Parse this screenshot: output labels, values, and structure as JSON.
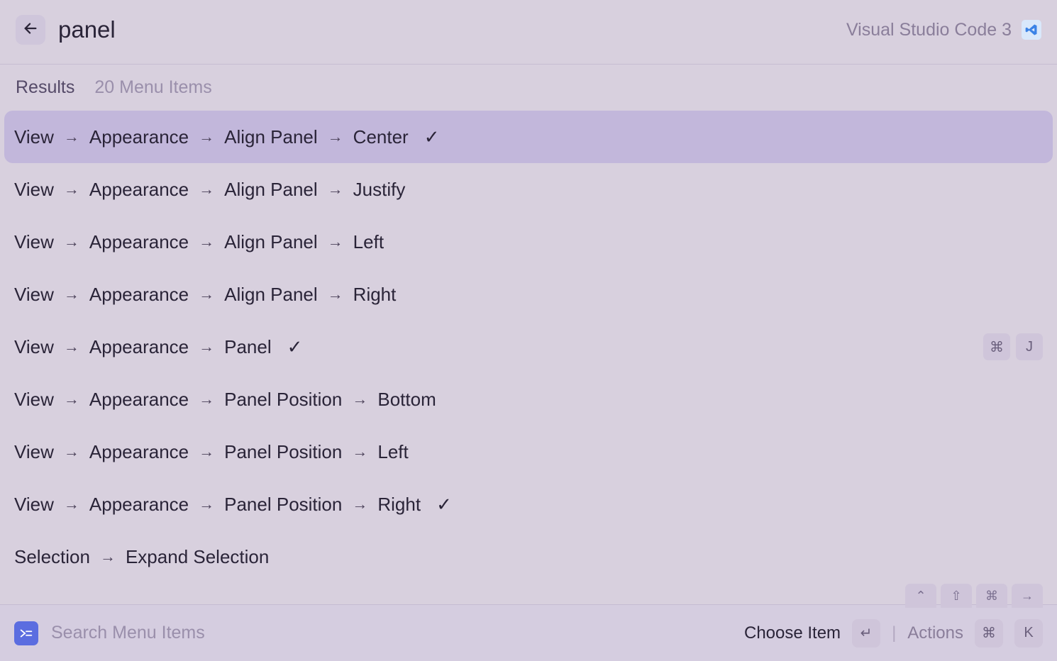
{
  "header": {
    "query": "panel",
    "app_name": "Visual Studio Code 3"
  },
  "results_header": {
    "label": "Results",
    "count_text": "20 Menu Items"
  },
  "results": [
    {
      "path": [
        "View",
        "Appearance",
        "Align Panel",
        "Center"
      ],
      "checked": true,
      "selected": true
    },
    {
      "path": [
        "View",
        "Appearance",
        "Align Panel",
        "Justify"
      ],
      "checked": false
    },
    {
      "path": [
        "View",
        "Appearance",
        "Align Panel",
        "Left"
      ],
      "checked": false
    },
    {
      "path": [
        "View",
        "Appearance",
        "Align Panel",
        "Right"
      ],
      "checked": false
    },
    {
      "path": [
        "View",
        "Appearance",
        "Panel"
      ],
      "checked": true,
      "shortcut": [
        "⌘",
        "J"
      ]
    },
    {
      "path": [
        "View",
        "Appearance",
        "Panel Position",
        "Bottom"
      ],
      "checked": false
    },
    {
      "path": [
        "View",
        "Appearance",
        "Panel Position",
        "Left"
      ],
      "checked": false
    },
    {
      "path": [
        "View",
        "Appearance",
        "Panel Position",
        "Right"
      ],
      "checked": true
    },
    {
      "path": [
        "Selection",
        "Expand Selection"
      ],
      "checked": false,
      "shortcut_partial": [
        "⌃",
        "⇧",
        "⌘",
        "→"
      ]
    }
  ],
  "footer": {
    "search_placeholder": "Search Menu Items",
    "choose_label": "Choose Item",
    "choose_key": "↵",
    "actions_label": "Actions",
    "actions_keys": [
      "⌘",
      "K"
    ]
  }
}
